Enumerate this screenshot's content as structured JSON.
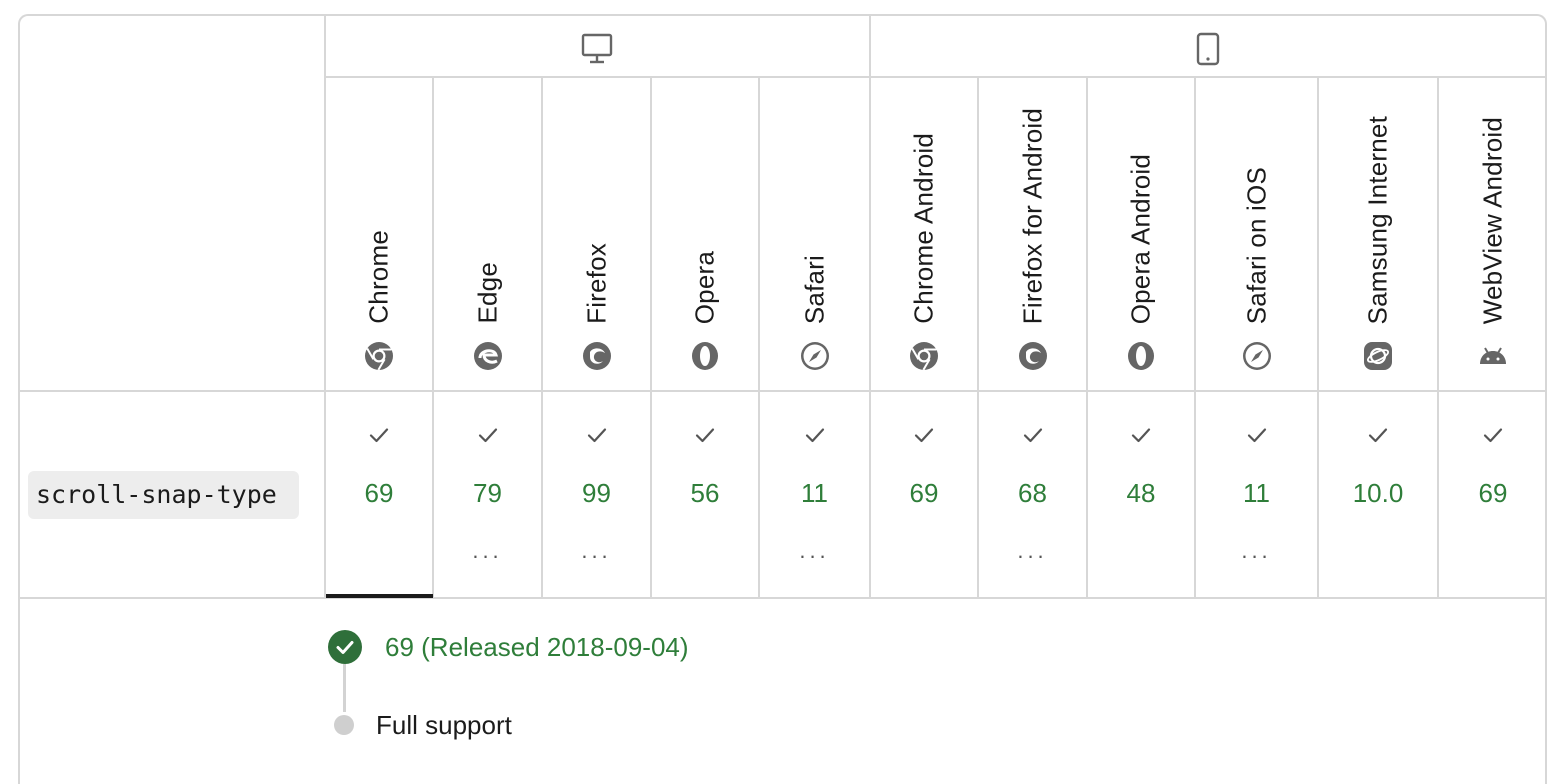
{
  "platforms": {
    "desktop_icon": "desktop-icon",
    "mobile_icon": "mobile-icon"
  },
  "browsers": [
    {
      "name": "Chrome",
      "icon": "chrome-icon",
      "version": "69",
      "check": "check-icon",
      "has_more": false
    },
    {
      "name": "Edge",
      "icon": "edge-icon",
      "version": "79",
      "check": "check-icon",
      "has_more": true
    },
    {
      "name": "Firefox",
      "icon": "firefox-icon",
      "version": "99",
      "check": "check-icon",
      "has_more": true
    },
    {
      "name": "Opera",
      "icon": "opera-icon",
      "version": "56",
      "check": "check-icon",
      "has_more": false
    },
    {
      "name": "Safari",
      "icon": "safari-icon",
      "version": "11",
      "check": "check-icon",
      "has_more": true
    },
    {
      "name": "Chrome Android",
      "icon": "chrome-icon",
      "version": "69",
      "check": "check-icon",
      "has_more": false
    },
    {
      "name": "Firefox for Android",
      "icon": "firefox-icon",
      "version": "68",
      "check": "check-icon",
      "has_more": true
    },
    {
      "name": "Opera Android",
      "icon": "opera-icon",
      "version": "48",
      "check": "check-icon",
      "has_more": false
    },
    {
      "name": "Safari on iOS",
      "icon": "safari-icon",
      "version": "11",
      "check": "check-icon",
      "has_more": true
    },
    {
      "name": "Samsung Internet",
      "icon": "samsung-internet-icon",
      "version": "10.0",
      "check": "check-icon",
      "has_more": false
    },
    {
      "name": "WebView Android",
      "icon": "android-icon",
      "version": "69",
      "check": "check-icon",
      "has_more": false
    }
  ],
  "more_label": "...",
  "feature": {
    "name": "scroll-snap-type"
  },
  "detail": {
    "version_line": "69 (Released 2018-09-04)",
    "support_label": "Full support"
  },
  "colors": {
    "supported_text": "#2f7e3a",
    "border": "#d7d7d7"
  }
}
